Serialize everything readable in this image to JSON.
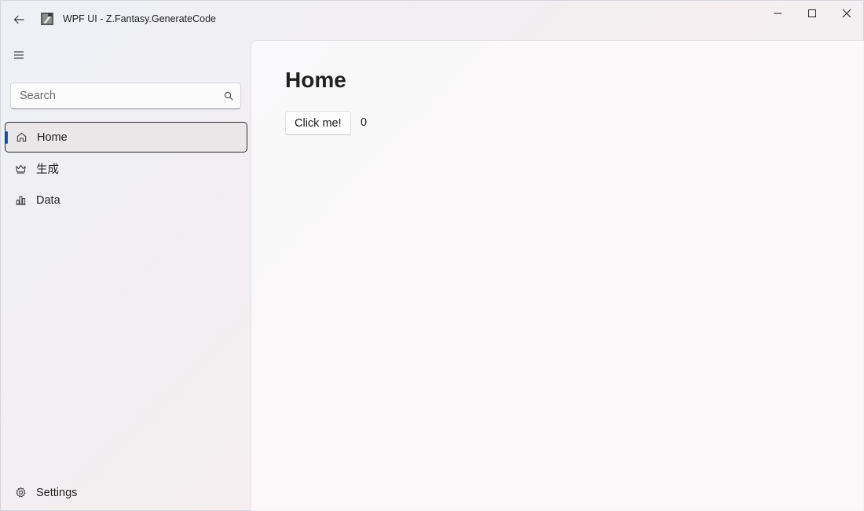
{
  "window": {
    "title": "WPF UI - Z.Fantasy.GenerateCode",
    "accent_color": "#0a5fb8"
  },
  "titlebar": {
    "back_icon": "arrow-left-icon",
    "minimize_icon": "minimize-icon",
    "maximize_icon": "maximize-icon",
    "close_icon": "close-icon"
  },
  "sidebar": {
    "search": {
      "placeholder": "Search",
      "value": ""
    },
    "items": [
      {
        "label": "Home",
        "icon": "home-icon",
        "active": true
      },
      {
        "label": "生成",
        "icon": "crown-icon",
        "active": false
      },
      {
        "label": "Data",
        "icon": "bar-chart-icon",
        "active": false
      }
    ],
    "footer": {
      "label": "Settings",
      "icon": "gear-icon"
    }
  },
  "main": {
    "title": "Home",
    "button_label": "Click me!",
    "counter": "0"
  }
}
